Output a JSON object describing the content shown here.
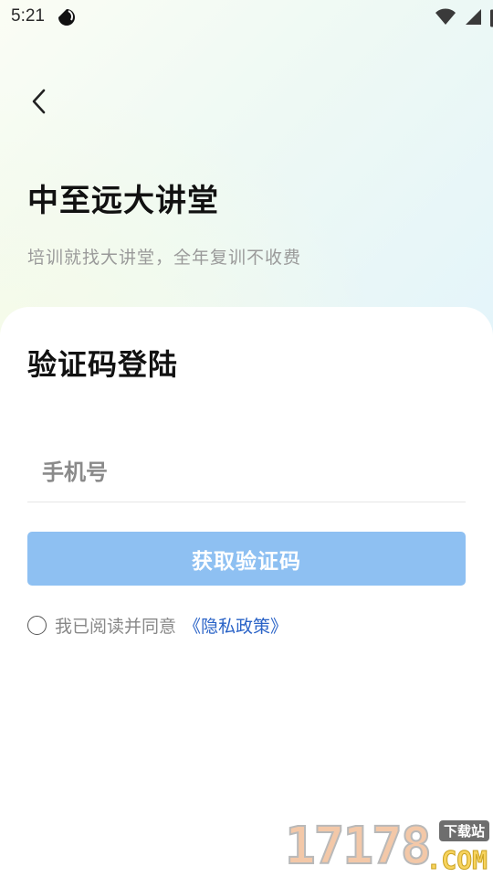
{
  "status_bar": {
    "time": "5:21"
  },
  "header": {
    "title": "中至远大讲堂",
    "subtitle": "培训就找大讲堂，全年复训不收费"
  },
  "login": {
    "title": "验证码登陆",
    "phone_placeholder": "手机号",
    "phone_value": "",
    "get_code_label": "获取验证码",
    "agree_checked": false,
    "agree_text": "我已阅读并同意",
    "policy_link": "《隐私政策》"
  },
  "watermark": {
    "number": "17178",
    "tag": "下载站",
    "domain": ".COM"
  },
  "colors": {
    "button_bg": "#8ec0f2",
    "link": "#2a63c7",
    "title": "#111111",
    "subtitle": "#9a9a9a"
  }
}
